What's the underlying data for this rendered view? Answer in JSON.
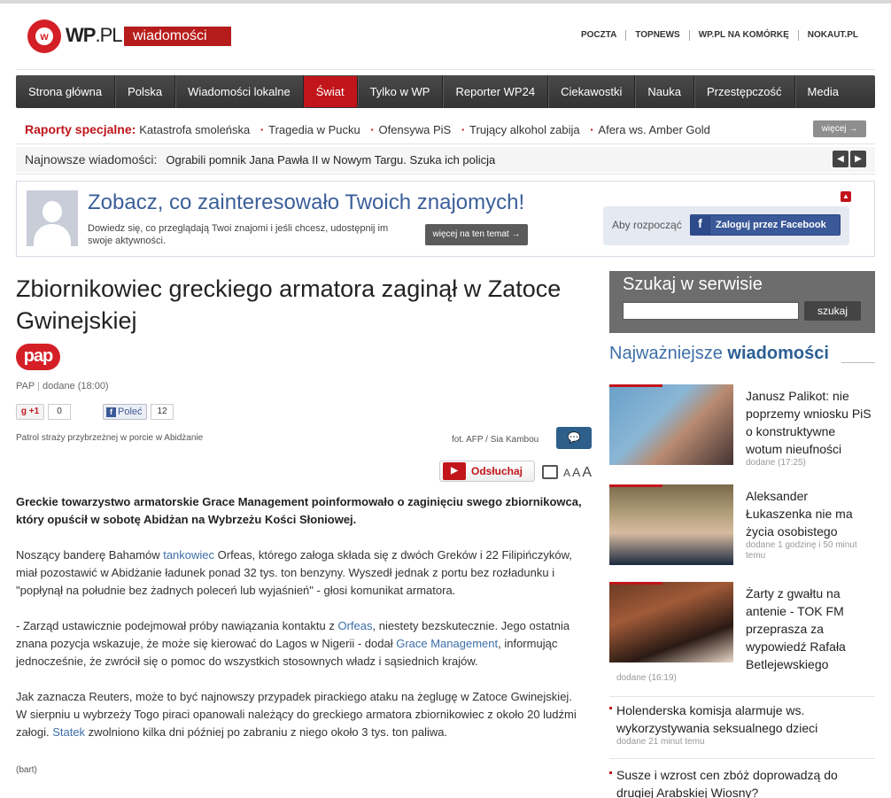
{
  "header": {
    "logo_text": "WP",
    "logo_suffix": ".PL",
    "section_badge": "wiadomości",
    "top_links": [
      "POCZTA",
      "TOPNEWS",
      "WP.PL NA KOMÓRKĘ",
      "NOKAUT.PL"
    ]
  },
  "nav": {
    "items": [
      "Strona główna",
      "Polska",
      "Wiadomości lokalne",
      "Świat",
      "Tylko w WP",
      "Reporter WP24",
      "Ciekawostki",
      "Nauka",
      "Przestępczość",
      "Media"
    ],
    "active": "Świat"
  },
  "raporty": {
    "label": "Raporty specjalne:",
    "items": [
      "Katastrofa smoleńska",
      "Tragedia w Pucku",
      "Ofensywa PiS",
      "Trujący alkohol zabija",
      "Afera ws. Amber Gold"
    ],
    "more": "więcej →"
  },
  "najnowsze": {
    "label": "Najnowsze wiadomości:",
    "text": "Ograbili pomnik Jana Pawła II w Nowym Targu. Szuka ich policja"
  },
  "facebook": {
    "title": "Zobacz, co zainteresowało Twoich znajomych!",
    "desc": "Dowiedz się, co przeglądają Twoi znajomi i jeśli chcesz, udostępnij im swoje aktywności.",
    "more": "więcej na ten temat →",
    "aby": "Aby rozpocząć",
    "login": "Zaloguj przez Facebook"
  },
  "article": {
    "headline": "Zbiornikowiec greckiego armatora zaginął w Zatoce Gwinejskiej",
    "source_logo": "pap",
    "source": "PAP",
    "added": "dodane (18:00)",
    "gplus": "+1",
    "gplus_count": "0",
    "fb_like": "Poleć",
    "fb_count": "12",
    "photo_caption": "Patrol straży przybrzeżnej w porcie w Abidżanie",
    "photo_credit": "fot. AFP / Sia Kambou",
    "listen": "Odsłuchaj",
    "lead": "Greckie towarzystwo armatorskie Grace Management poinformowało o zaginięciu swego zbiornikowca, który opuścił w sobotę Abidżan na Wybrzeżu Kości Słoniowej.",
    "p1a": "Noszący banderę Bahamów ",
    "p1link": "tankowiec",
    "p1b": " Orfeas, którego załoga składa się z dwóch Greków i 22 Filipińczyków, miał pozostawić w Abidżanie ładunek ponad 32 tys. ton benzyny. Wyszedł jednak z portu bez rozładunku i \"popłynął na południe bez żadnych poleceń lub wyjaśnień\" - głosi komunikat armatora.",
    "p2a": "- Zarząd ustawicznie podejmował próby nawiązania kontaktu z ",
    "p2link1": "Orfeas",
    "p2b": ", niestety bezskutecznie. Jego ostatnia znana pozycja wskazuje, że może się kierować do Lagos w Nigerii - dodał ",
    "p2link2": "Grace Management",
    "p2c": ", informując jednocześnie, że zwrócił się o pomoc do wszystkich stosownych władz i sąsiednich krajów.",
    "p3a": "Jak zaznacza Reuters, może to być najnowszy przypadek pirackiego ataku na żeglugę w Zatoce Gwinejskiej. W sierpniu u wybrzeży Togo piraci opanowali należący do greckiego armatora zbiornikowiec z około 20 ludźmi załogi. ",
    "p3link": "Statek",
    "p3b": " zwolniono kilka dni później po zabraniu z niego około 3 tys. ton paliwa.",
    "author": "(bart)"
  },
  "sidebar": {
    "search_title": "Szukaj w serwisie",
    "search_button": "szukaj",
    "najw_a": "Najważniejsze",
    "najw_b": "wiadomości",
    "news": [
      {
        "title": "Janusz Palikot: nie poprzemy wniosku PiS o konstruktywne wotum nieufności",
        "time": "dodane (17:25)"
      },
      {
        "title": "Aleksander Łukaszenka nie ma życia osobistego",
        "time": "dodane 1 godzinę i 50 minut temu"
      },
      {
        "title": "Żarty z gwałtu na antenie - TOK FM przeprasza za wypowiedź Rafała Betlejewskiego",
        "time": "dodane (16:19)"
      }
    ],
    "list": [
      {
        "title": "Holenderska komisja alarmuje ws. wykorzystywania seksualnego dzieci",
        "time": "dodane 21 minut temu"
      },
      {
        "title": "Susze i wzrost cen zbóż doprowadzą do drugiej Arabskiej Wiosny?",
        "time": ""
      }
    ]
  }
}
